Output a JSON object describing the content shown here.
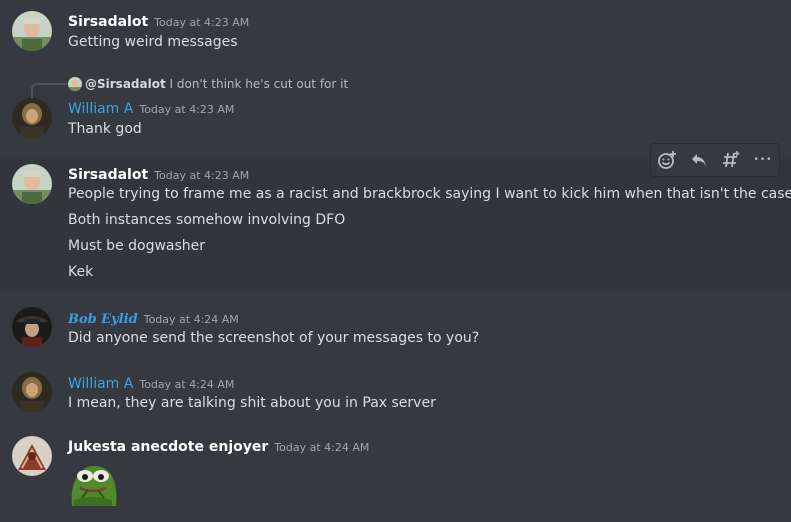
{
  "messages": [
    {
      "author": "Sirsadalot",
      "timestamp": "Today at 4:23 AM",
      "lines": [
        "Getting weird messages"
      ]
    },
    {
      "reply_to": {
        "mention": "@Sirsadalot",
        "text": "I don't think he's cut out for it"
      },
      "author": "William A",
      "timestamp": "Today at 4:23 AM",
      "lines": [
        "Thank god"
      ]
    },
    {
      "author": "Sirsadalot",
      "timestamp": "Today at 4:23 AM",
      "lines": [
        "People trying to frame me as a racist and brackbrock saying I want to kick him when that isn't the case",
        "Both instances somehow involving DFO",
        "Must be dogwasher",
        "Kek"
      ]
    },
    {
      "author": "Bob Eylid",
      "timestamp": "Today at 4:24 AM",
      "lines": [
        "Did anyone send the screenshot of your messages to you?"
      ]
    },
    {
      "author": "William A",
      "timestamp": "Today at 4:24 AM",
      "lines": [
        "I mean, they are talking shit about you in Pax server"
      ]
    },
    {
      "author": "Jukesta anecdote enjoyer",
      "timestamp": "Today at 4:24 AM",
      "lines": []
    }
  ],
  "toolbar": {
    "icons": [
      "add-reaction-icon",
      "reply-icon",
      "create-thread-icon",
      "more-icon"
    ],
    "more_glyph": "•••"
  },
  "colors": {
    "background": "#36393f",
    "hover": "#32353b",
    "username_default": "#ffffff",
    "username_blue": "#3ba5e8",
    "text": "#dcddde",
    "timestamp": "#a3a6aa"
  }
}
